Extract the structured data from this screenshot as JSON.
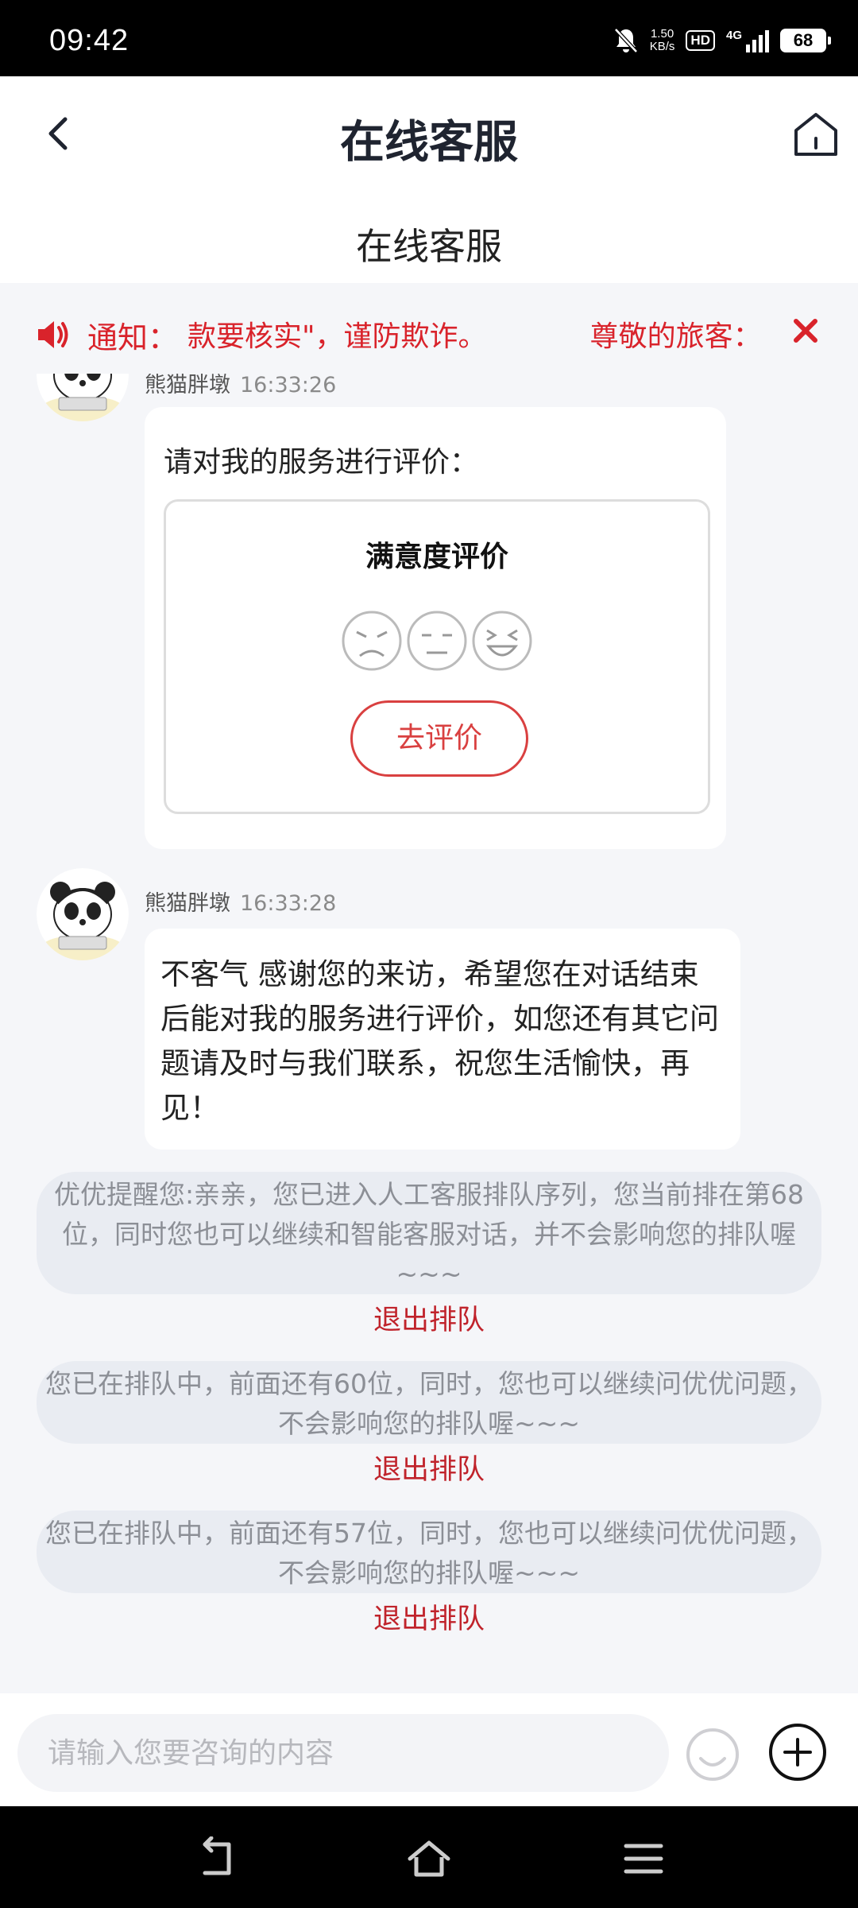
{
  "status_bar": {
    "time": "09:42",
    "net_speed_value": "1.50",
    "net_speed_unit": "KB/s",
    "hd_badge": "HD",
    "network_type": "4G",
    "battery": "68",
    "icons": [
      "mute-bell-icon",
      "hd-icon",
      "signal-icon",
      "battery-icon"
    ]
  },
  "header": {
    "title": "在线客服",
    "back_icon": "chevron-left-icon",
    "home_icon": "home-icon"
  },
  "subheader": {
    "title": "在线客服"
  },
  "notice": {
    "label": "通知：",
    "text": "款要核实\"，谨防欺诈。",
    "text_tail": "尊敬的旅客：",
    "icons": [
      "speaker-icon",
      "close-icon"
    ],
    "color": "#d9232b"
  },
  "messages": [
    {
      "sender": "熊猫胖墩",
      "time": "16:33:26",
      "prompt": "请对我的服务进行评价：",
      "card_title": "满意度评价",
      "faces": [
        "angry-face-icon",
        "neutral-face-icon",
        "happy-face-icon"
      ],
      "button_label": "去评价"
    },
    {
      "sender": "熊猫胖墩",
      "time": "16:33:28",
      "text": "不客气 感谢您的来访，希望您在对话结束后能对我的服务进行评价，如您还有其它问题请及时与我们联系，祝您生活愉快，再见！"
    }
  ],
  "system_notes": [
    {
      "text": "优优提醒您:亲亲，您已进入人工客服排队序列，您当前排在第68位，同时您也可以继续和智能客服对话，并不会影响您的排队喔~~~",
      "link": "退出排队"
    },
    {
      "text": "您已在排队中，前面还有60位，同时，您也可以继续问优优问题，不会影响您的排队喔~~~",
      "link": "退出排队"
    },
    {
      "text": "您已在排队中，前面还有57位，同时，您也可以继续问优优问题，不会影响您的排队喔~~~",
      "link": "退出排队"
    }
  ],
  "input_bar": {
    "placeholder": "请输入您要咨询的内容",
    "emoji_icon": "smiley-icon",
    "plus_icon": "plus-circle-icon"
  },
  "nav_bar": {
    "icons": [
      "back-nav-icon",
      "home-nav-icon",
      "menu-nav-icon"
    ]
  },
  "colors": {
    "accent_red": "#d9232b",
    "rate_button": "#d94040",
    "background": "#f5f6f9"
  }
}
